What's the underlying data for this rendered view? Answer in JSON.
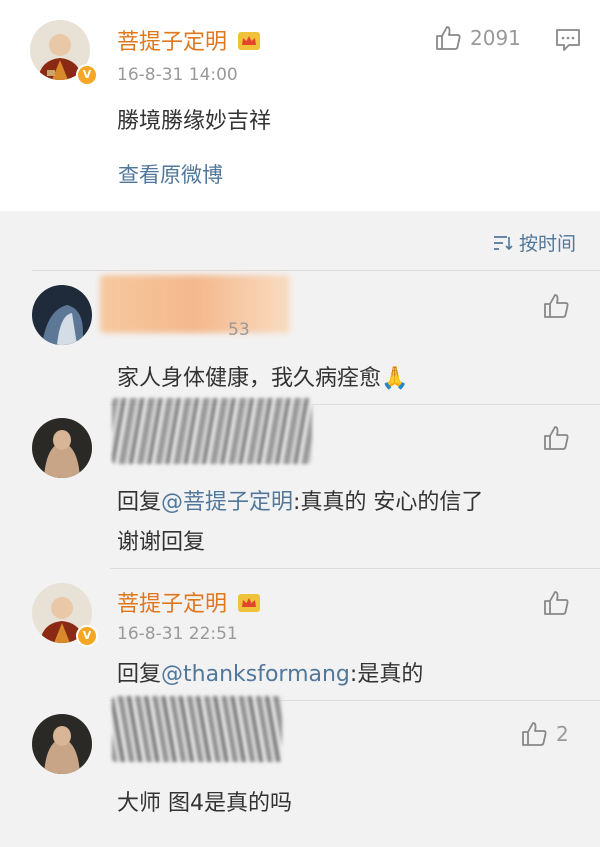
{
  "post": {
    "author": "菩提子定明",
    "time": "16-8-31 14:00",
    "text": "勝境勝缘妙吉祥",
    "like_count": "2091",
    "view_original": "查看原微博"
  },
  "sort_label": "按时间",
  "comments": [
    {
      "time_fragment": "53",
      "text": "家人身体健康，我久病痊愈🙏"
    },
    {
      "text_prefix": "回复",
      "mention": "@菩提子定明",
      "text_suffix": ":真真的 安心的信了",
      "text_line2": "谢谢回复"
    },
    {
      "author": "菩提子定明",
      "time": "16-8-31 22:51",
      "text_prefix": "回复",
      "mention": "@thanksformang",
      "text_suffix": ":是真的"
    },
    {
      "like_count": "2",
      "text": "大师 图4是真的吗"
    }
  ],
  "colors": {
    "author_orange": "#e0771b",
    "link_blue": "#51779a",
    "muted_gray": "#999999"
  }
}
